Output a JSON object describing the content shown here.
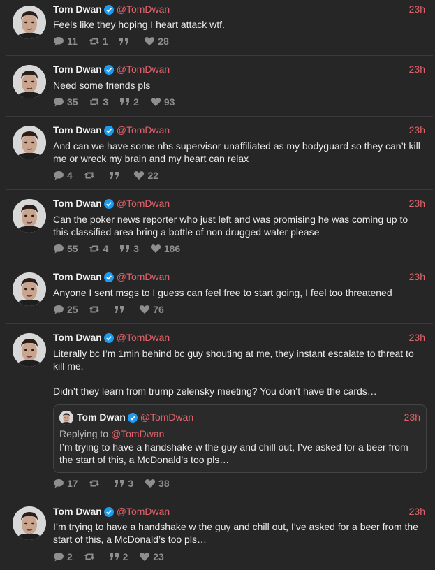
{
  "tweets": [
    {
      "name": "Tom Dwan",
      "handle": "@TomDwan",
      "time": "23h",
      "text": "Feels like they hoping I heart attack wtf.",
      "replies": "11",
      "retweets": "1",
      "quotes": "",
      "likes": "28"
    },
    {
      "name": "Tom Dwan",
      "handle": "@TomDwan",
      "time": "23h",
      "text": "Need some friends pls",
      "replies": "35",
      "retweets": "3",
      "quotes": "2",
      "likes": "93"
    },
    {
      "name": "Tom Dwan",
      "handle": "@TomDwan",
      "time": "23h",
      "text": "And can we have some nhs supervisor unaffiliated as my bodyguard so they can’t kill me or wreck my brain and my heart can relax",
      "replies": "4",
      "retweets": "",
      "quotes": "",
      "likes": "22"
    },
    {
      "name": "Tom Dwan",
      "handle": "@TomDwan",
      "time": "23h",
      "text": "Can the poker news reporter who just left and was promising he was coming up to this classified area bring a bottle of non drugged water please",
      "replies": "55",
      "retweets": "4",
      "quotes": "3",
      "likes": "186"
    },
    {
      "name": "Tom Dwan",
      "handle": "@TomDwan",
      "time": "23h",
      "text": "Anyone I sent msgs to I guess can feel free to start going, I feel too threatened",
      "replies": "25",
      "retweets": "",
      "quotes": "",
      "likes": "76"
    },
    {
      "name": "Tom Dwan",
      "handle": "@TomDwan",
      "time": "23h",
      "text": "Literally bc I’m 1min behind bc guy shouting at me, they instant escalate to threat to kill me.\n\nDidn’t they learn from trump zelensky meeting? You don’t have the cards…",
      "replies": "17",
      "retweets": "",
      "quotes": "3",
      "likes": "38",
      "quote": {
        "name": "Tom Dwan",
        "handle": "@TomDwan",
        "time": "23h",
        "replying_prefix": "Replying to ",
        "replying_handle": "@TomDwan",
        "text": "I’m trying to have a handshake w the guy and chill out, I’ve asked for a beer from the start of this, a McDonald’s too pls…"
      }
    },
    {
      "name": "Tom Dwan",
      "handle": "@TomDwan",
      "time": "23h",
      "text": "I’m trying to have a handshake w the guy and chill out, I’ve asked for a beer from the start of this, a McDonald’s too pls…",
      "replies": "2",
      "retweets": "",
      "quotes": "2",
      "likes": "23"
    }
  ],
  "colors": {
    "background": "#262626",
    "accent": "#e0636b",
    "verified": "#1d9bf0",
    "muted": "#8e8e8e"
  }
}
